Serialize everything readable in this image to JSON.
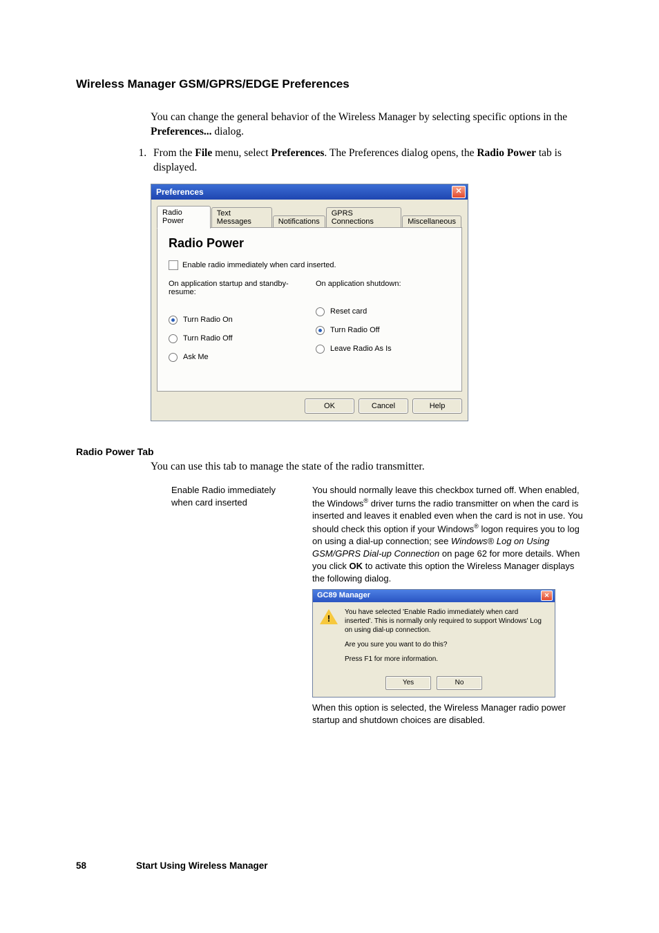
{
  "heading": "Wireless Manager GSM/GPRS/EDGE Preferences",
  "intro": {
    "p1_a": "You can change the general behavior of the Wireless Manager by selecting specific options in the ",
    "p1_b": "Preferences...",
    "p1_c": " dialog."
  },
  "step1": {
    "a": "From the ",
    "b": "File",
    "c": " menu, select ",
    "d": "Preferences",
    "e": ". The Preferences dialog opens, the ",
    "f": "Radio Power",
    "g": " tab is displayed."
  },
  "dialog": {
    "title": "Preferences",
    "tabs": [
      "Radio Power",
      "Text Messages",
      "Notifications",
      "GPRS Connections",
      "Miscellaneous"
    ],
    "panel_heading": "Radio Power",
    "checkbox_label": "Enable radio immediately when card inserted.",
    "left_label": "On application startup and standby-resume:",
    "right_label": "On application shutdown:",
    "left_opts": [
      "Turn Radio On",
      "Turn Radio Off",
      "Ask Me"
    ],
    "right_opts": [
      "Reset card",
      "Turn Radio Off",
      "Leave Radio As Is"
    ],
    "left_selected": 0,
    "right_selected": 1,
    "buttons": {
      "ok": "OK",
      "cancel": "Cancel",
      "help": "Help"
    }
  },
  "sub_heading": "Radio Power Tab",
  "sub_intro": "You can use this tab to manage the state of the radio transmitter.",
  "def": {
    "left_l1": "Enable Radio immediately",
    "left_l2": "when card inserted",
    "r_a": "You should normally leave this checkbox turned off. When enabled, the Windows",
    "r_reg1": "®",
    "r_b": " driver turns the radio transmitter on when the card is inserted and leaves it enabled even when the card is not in use. You should check this option if your Windows",
    "r_reg2": "®",
    "r_c": " logon requires you to log on using a dial-up connection; see ",
    "r_ital": "Windows® Log on Using GSM/GPRS Dial-up Connection",
    "r_d": " on page 62 for more details. When you click ",
    "r_bold": "OK",
    "r_e": " to activate this option the Wireless Manager displays the following dialog.",
    "followup": "When this option is selected, the Wireless Manager radio power startup and shutdown choices are disabled."
  },
  "confirm": {
    "title": "GC89 Manager",
    "msg1": "You have selected 'Enable Radio immediately when card inserted'. This is normally only required to support Windows' Log on using dial-up connection.",
    "msg2": "Are you sure you want to do this?",
    "msg3": "Press F1 for more information.",
    "yes": "Yes",
    "no": "No"
  },
  "footer": {
    "page": "58",
    "section": "Start Using Wireless Manager"
  }
}
